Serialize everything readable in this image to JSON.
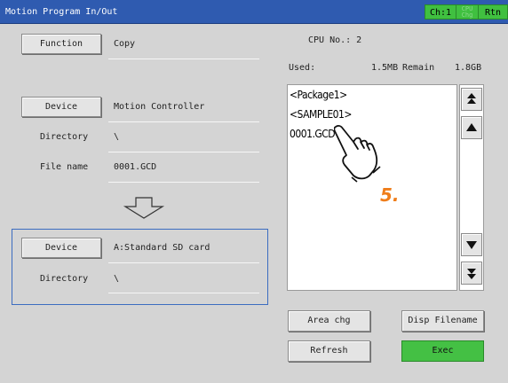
{
  "window": {
    "title": "Motion Program In/Out",
    "ch_button": "Ch:1",
    "cpu_button": [
      "CPU",
      "Chg"
    ],
    "rtn_button": "Rtn"
  },
  "source": {
    "function_button": "Function",
    "function_value": "Copy",
    "device_button": "Device",
    "device_value": "Motion Controller",
    "directory_label": "Directory",
    "directory_value": "\\",
    "filename_label": "File name",
    "filename_value": "0001.GCD"
  },
  "destination": {
    "device_button": "Device",
    "device_value": "A:Standard SD card",
    "directory_label": "Directory",
    "directory_value": "\\"
  },
  "info": {
    "cpu_no": "CPU No.: 2",
    "used_label": "Used:",
    "used_value": "1.5MB",
    "remain_label": "Remain",
    "remain_value": "1.8GB"
  },
  "file_list": [
    "<Package1>",
    "<SAMPLE01>",
    "0001.GCD"
  ],
  "buttons": {
    "area_chg": "Area chg",
    "disp_filename": "Disp Filename",
    "refresh": "Refresh",
    "exec": "Exec"
  },
  "annotation": {
    "step": "5."
  },
  "colors": {
    "titlebar": "#2f5bb0",
    "green_button": "#44c044",
    "step_orange": "#ef7d1a",
    "dest_border": "#3c6cc0"
  }
}
